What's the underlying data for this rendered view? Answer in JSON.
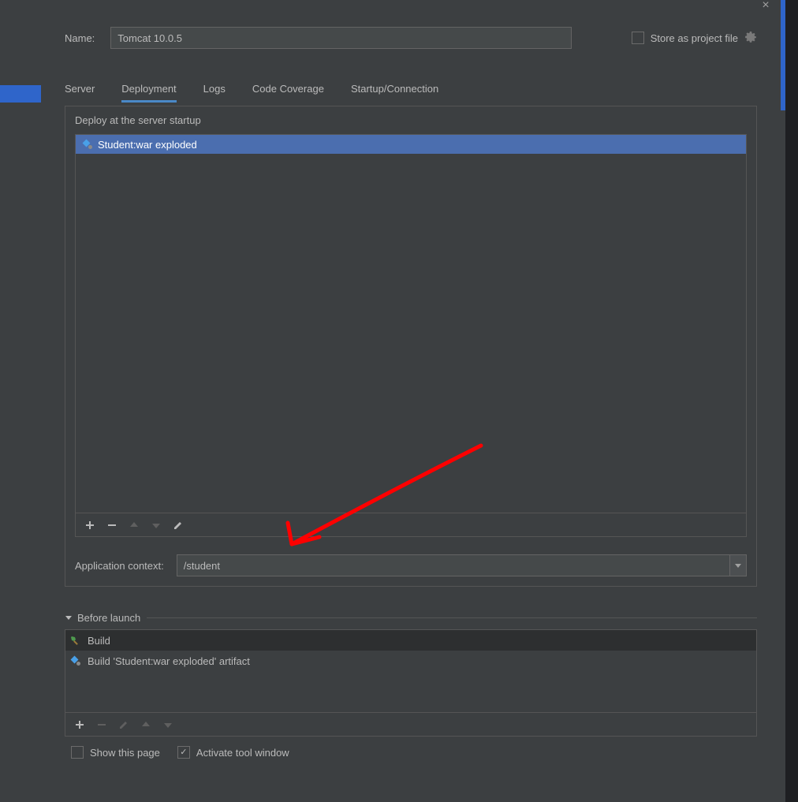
{
  "nameRow": {
    "label": "Name:",
    "value": "Tomcat 10.0.5",
    "storeLabel": "Store as project file"
  },
  "tabs": {
    "items": [
      {
        "label": "Server"
      },
      {
        "label": "Deployment"
      },
      {
        "label": "Logs"
      },
      {
        "label": "Code Coverage"
      },
      {
        "label": "Startup/Connection"
      }
    ]
  },
  "deploy": {
    "sectionLabel": "Deploy at the server startup",
    "artifacts": [
      {
        "label": "Student:war exploded"
      }
    ],
    "contextLabel": "Application context:",
    "contextValue": "/student"
  },
  "beforeLaunch": {
    "title": "Before launch",
    "items": [
      {
        "label": "Build",
        "icon": "hammer"
      },
      {
        "label": "Build 'Student:war exploded' artifact",
        "icon": "artifact"
      }
    ]
  },
  "footer": {
    "showPageLabel": "Show this page",
    "activateLabel": "Activate tool window"
  }
}
